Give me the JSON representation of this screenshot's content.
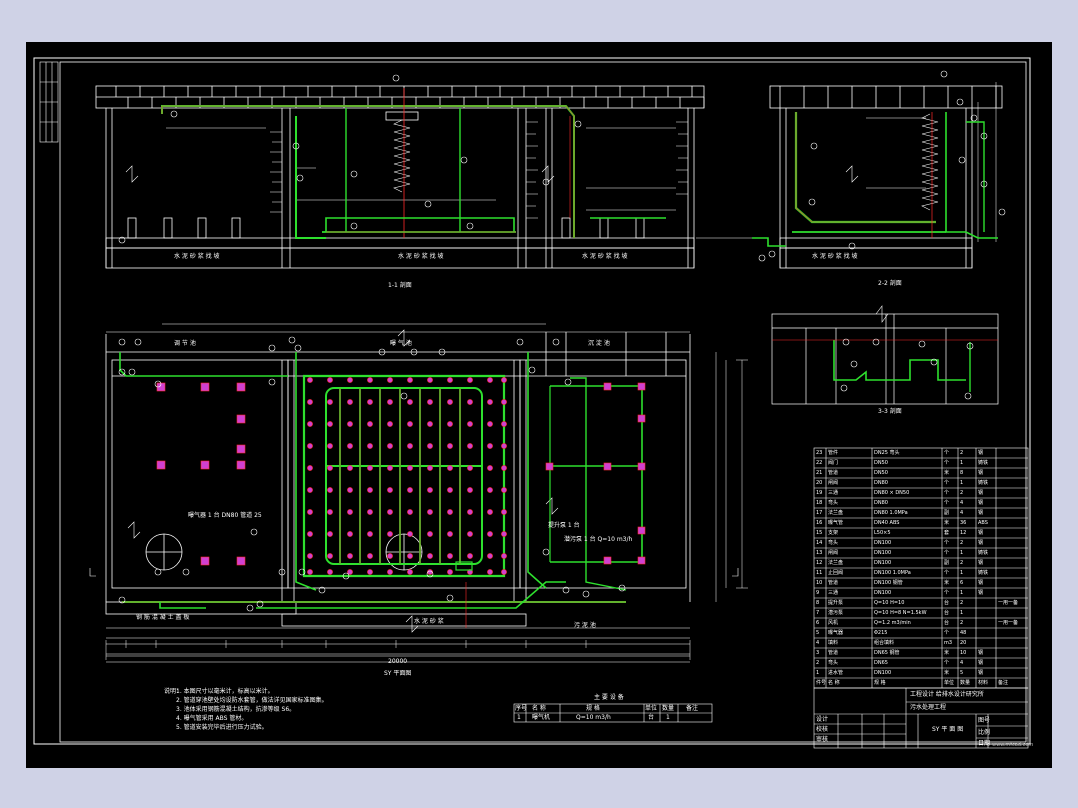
{
  "drawing": {
    "colors": {
      "background": "#000000",
      "structure": "#ffffff",
      "pipe_green": "#2ee02e",
      "pipe_red": "#ff2a2a",
      "marker_magenta": "#d040d0",
      "page_bg": "#cfd2e6"
    },
    "section_titles": {
      "section_1": "1-1 剖面",
      "section_2": "2-2 剖面",
      "section_3": "3-3 剖面",
      "plan": "SY 平面图"
    },
    "section_notes": {
      "floor_text": "水 泥 砂 浆 找 坡",
      "floor_text_2": "水 泥 砂 浆 找 坡",
      "floor_text_3": "水 泥 砂 浆 找 坡",
      "floor_text_right": "水 泥 砂 浆 找 坡"
    },
    "plan_labels": {
      "zone_a": "调 节 池",
      "zone_b": "曝 气 池",
      "zone_c": "沉 淀 池",
      "zone_d": "污 泥 池",
      "bottom_text": "钢 筋 混 凝 土 盖 板",
      "bottom_text_2": "水 泥 砂 浆",
      "note_a": "曝气器 1 台 DN80 管道 25",
      "note_b": "提升泵 1 台",
      "note_c": "潜污泵 1 台 Q=10 m3/h",
      "total_dim": "20000"
    },
    "notes": {
      "heading": "说明：",
      "items": [
        "1. 本图尺寸以毫米计，标高以米计。",
        "2. 管道穿池壁处均设防水套管，做法详见国家标准图集。",
        "3. 池体采用钢筋混凝土结构，抗渗等级 S6。",
        "4. 曝气管采用 ABS 管材。",
        "5. 管道安装完毕后进行压力试验。"
      ]
    },
    "small_table": {
      "title": "主 要 设 备",
      "headers": [
        "序号",
        "名  称",
        "规  格",
        "单位",
        "数量",
        "备注"
      ],
      "rows": [
        [
          "1",
          "曝气机",
          "Q=10 m3/h",
          "台",
          "1",
          ""
        ]
      ]
    },
    "materials_table": {
      "headers": [
        "件号",
        "名  称",
        "规  格",
        "单位",
        "数量",
        "材料",
        "备注"
      ],
      "rows": [
        [
          "23",
          "管件",
          "DN25 弯头",
          "个",
          "2",
          "钢",
          ""
        ],
        [
          "22",
          "阀门",
          "DN50",
          "个",
          "1",
          "铸铁",
          ""
        ],
        [
          "21",
          "管道",
          "DN50",
          "米",
          "8",
          "钢",
          ""
        ],
        [
          "20",
          "闸阀",
          "DN80",
          "个",
          "1",
          "铸铁",
          ""
        ],
        [
          "19",
          "三通",
          "DN80 × DN50",
          "个",
          "2",
          "钢",
          ""
        ],
        [
          "18",
          "弯头",
          "DN80",
          "个",
          "4",
          "钢",
          ""
        ],
        [
          "17",
          "法兰盘",
          "DN80 1.0MPa",
          "副",
          "4",
          "钢",
          ""
        ],
        [
          "16",
          "曝气管",
          "DN40 ABS",
          "米",
          "36",
          "ABS",
          ""
        ],
        [
          "15",
          "支架",
          "L50×5",
          "套",
          "12",
          "钢",
          ""
        ],
        [
          "14",
          "弯头",
          "DN100",
          "个",
          "2",
          "钢",
          ""
        ],
        [
          "13",
          "闸阀",
          "DN100",
          "个",
          "1",
          "铸铁",
          ""
        ],
        [
          "12",
          "法兰盘",
          "DN100",
          "副",
          "2",
          "钢",
          ""
        ],
        [
          "11",
          "止回阀",
          "DN100 1.0MPa",
          "个",
          "1",
          "铸铁",
          ""
        ],
        [
          "10",
          "管道",
          "DN100 钢管",
          "米",
          "6",
          "钢",
          ""
        ],
        [
          "9",
          "三通",
          "DN100",
          "个",
          "1",
          "钢",
          ""
        ],
        [
          "8",
          "提升泵",
          "Q=10 H=10",
          "台",
          "2",
          "",
          "一用一备"
        ],
        [
          "7",
          "潜污泵",
          "Q=10 H=8 N=1.5kW",
          "台",
          "1",
          "",
          ""
        ],
        [
          "6",
          "风机",
          "Q=1.2 m3/min",
          "台",
          "2",
          "",
          "一用一备"
        ],
        [
          "5",
          "曝气器",
          "Φ215",
          "个",
          "48",
          "",
          ""
        ],
        [
          "4",
          "填料",
          "组合填料",
          "m3",
          "20",
          "",
          ""
        ],
        [
          "3",
          "管道",
          "DN65 钢管",
          "米",
          "10",
          "钢",
          ""
        ],
        [
          "2",
          "弯头",
          "DN65",
          "个",
          "4",
          "钢",
          ""
        ],
        [
          "1",
          "进水管",
          "DN100",
          "米",
          "5",
          "钢",
          ""
        ]
      ]
    },
    "title_block": {
      "company": "工程设计 给排水设计研究所",
      "project": "污水处理工程",
      "drawing_name": "SY 平 面 图",
      "role_labels": [
        "设计",
        "校核",
        "审核"
      ],
      "field_labels": [
        "图号",
        "比例",
        "日期"
      ]
    },
    "watermark": "www.mfcad.com"
  }
}
